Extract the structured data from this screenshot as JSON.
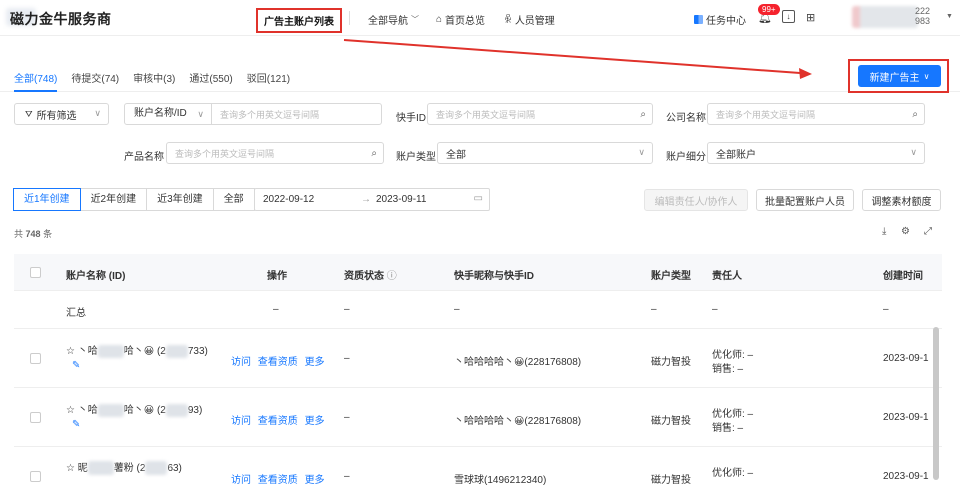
{
  "header": {
    "app_title": "磁力金牛服务商",
    "active_nav": "广告主账户列表",
    "nav": [
      "全部导航",
      "首页总览",
      "人员管理"
    ],
    "task_center": "任务中心",
    "badge": "99+",
    "account_id_top": "222",
    "account_id_bottom": "983"
  },
  "tabs": [
    {
      "label": "全部(748)",
      "active": true
    },
    {
      "label": "待提交(74)",
      "active": false
    },
    {
      "label": "审核中(3)",
      "active": false
    },
    {
      "label": "通过(550)",
      "active": false
    },
    {
      "label": "驳回(121)",
      "active": false
    }
  ],
  "new_advertiser_button": "新建广告主",
  "filters": {
    "all_filters": "所有筛选",
    "account_name_id_select": "账户名称/ID",
    "account_name_placeholder": "查询多个用英文逗号间隔",
    "kuaishou_id_label": "快手ID",
    "kuaishou_id_placeholder": "查询多个用英文逗号间隔",
    "company_name_label": "公司名称",
    "company_name_placeholder": "查询多个用英文逗号间隔",
    "product_name_label": "产品名称",
    "product_name_placeholder": "查询多个用英文逗号间隔",
    "account_type_label": "账户类型",
    "account_type_value": "全部",
    "account_detail_label": "账户细分",
    "account_detail_value": "全部账户"
  },
  "date_filter": {
    "segments": [
      "近1年创建",
      "近2年创建",
      "近3年创建",
      "全部"
    ],
    "active_segment": 0,
    "start": "2022-09-12",
    "arrow": "→",
    "end": "2023-09-11"
  },
  "actions": {
    "edit_owner": "编辑责任人/协作人",
    "batch_config": "批量配置账户人员",
    "adjust_quota": "调整素材额度"
  },
  "total": {
    "prefix": "共",
    "count": "748",
    "suffix": "条"
  },
  "table": {
    "headers": {
      "name": "账户名称 (ID)",
      "op": "操作",
      "status": "资质状态",
      "ks": "快手昵称与快手ID",
      "type": "账户类型",
      "owner": "责任人",
      "created": "创建时间"
    },
    "summary": {
      "name": "汇总",
      "op": "–",
      "status": "–",
      "ks": "–",
      "type": "–",
      "owner": "–",
      "created": "–"
    },
    "rows": [
      {
        "name_prefix": "丶哈",
        "name_mid": "哈丶😀",
        "id_prefix": "(2",
        "id_suffix": "733)",
        "ops": [
          "访问",
          "查看资质",
          "更多"
        ],
        "status": "–",
        "ks": "丶哈哈哈哈丶😀(228176808)",
        "type": "磁力智投",
        "optimizer": "优化师: –",
        "sales": "销售: –",
        "created": "2023-09-1"
      },
      {
        "name_prefix": "丶哈",
        "name_mid": "哈丶😀",
        "id_prefix": "(2",
        "id_suffix": "93)",
        "ops": [
          "访问",
          "查看资质",
          "更多"
        ],
        "status": "–",
        "ks": "丶哈哈哈哈丶😀(228176808)",
        "type": "磁力智投",
        "optimizer": "优化师: –",
        "sales": "销售: –",
        "created": "2023-09-1"
      },
      {
        "name_prefix": "昵",
        "name_mid": "薯粉",
        "id_prefix": "(2",
        "id_suffix": "63)",
        "ops": [
          "访问",
          "查看资质",
          "更多"
        ],
        "status": "–",
        "ks": "雪球球(1496212340)",
        "type": "磁力智投",
        "optimizer": "优化师: –",
        "sales": "",
        "created": "2023-09-1"
      }
    ]
  },
  "colors": {
    "primary": "#1677ff",
    "annotation": "#e0322b"
  }
}
